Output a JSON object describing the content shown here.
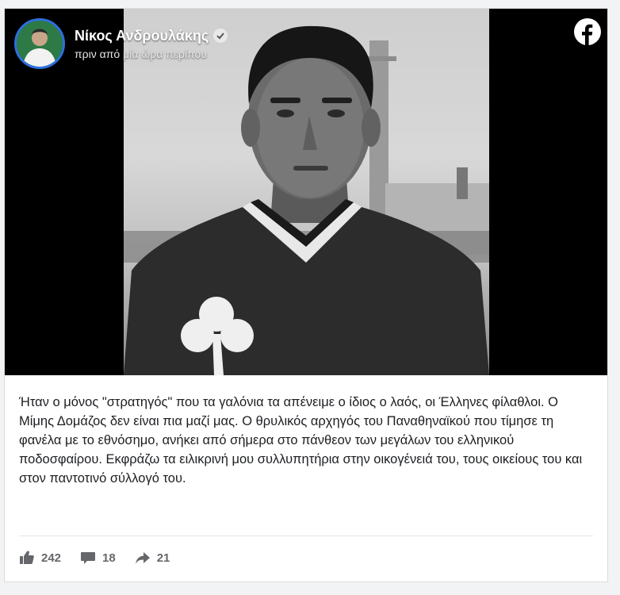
{
  "post": {
    "author": "Νίκος Ανδρουλάκης",
    "timestamp": "πριν από μία ώρα περίπου",
    "text": "Ήταν ο μόνος \"στρατηγός\" που τα γαλόνια τα απένειμε ο ίδιος ο λαός, οι Έλληνες φίλαθλοι. Ο Μίμης Δομάζος δεν είναι πια μαζί μας. Ο θρυλικός αρχηγός του Παναθηναϊκού που τίμησε τη φανέλα με το εθνόσημο, ανήκει από σήμερα στο πάνθεον των μεγάλων του ελληνικού ποδοσφαίρου. Εκφράζω τα ειλικρινή μου συλλυπητήρια στην οικογένειά του, τους οικείους του και στον παντοτινό σύλλογό του."
  },
  "stats": {
    "likes": "242",
    "comments": "18",
    "shares": "21"
  },
  "icons": {
    "brand": "facebook-icon",
    "verified": "verified-badge-icon",
    "like": "thumbs-up-icon",
    "comment": "comment-icon",
    "share": "share-icon"
  },
  "colors": {
    "avatar_ring": "#2d6fe0",
    "text": "#1c1e21",
    "muted": "#65676b",
    "media_bg": "#000000"
  }
}
